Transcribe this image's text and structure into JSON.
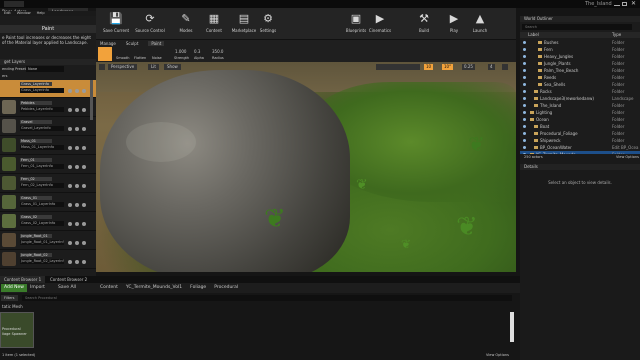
{
  "window": {
    "title": "The_Island",
    "menu": [
      "Edit",
      "Window",
      "Help"
    ],
    "tabs": [
      "Place Actors",
      "Landscape"
    ]
  },
  "mode_tabs": [
    "Paint"
  ],
  "paint_tooltip": "e Paint tool increases or decreases the eight of the Material layer applied to Landscape.",
  "target_layers": {
    "header": "get Layers",
    "blend_label": "ending Presets",
    "blend_value": "None",
    "section": "ers",
    "layers": [
      {
        "name": "Grass_Layerinfo",
        "field": "Grass_Layerinfo",
        "color": "#c98c3a",
        "selected": true
      },
      {
        "name": "Pebbles",
        "field": "Pebbles_LayerInfo",
        "color": "#6d6654"
      },
      {
        "name": "Gravel",
        "field": "Gravel_LayerInfo",
        "color": "#55524a"
      },
      {
        "name": "Moss_01",
        "field": "Moss_01_LayerInfo",
        "color": "#3f4d2a"
      },
      {
        "name": "Fern_01",
        "field": "Fern_01_LayerInfo",
        "color": "#4a5a2e"
      },
      {
        "name": "Fern_02",
        "field": "Fern_02_LayerInfo",
        "color": "#4d5833"
      },
      {
        "name": "Grass_01",
        "field": "Grass_01_LayerInfo",
        "color": "#56663a"
      },
      {
        "name": "Grass_02",
        "field": "Grass_02_LayerInfo",
        "color": "#5d6e3e"
      },
      {
        "name": "Jungle_Root_01",
        "field": "Jungle_Root_01_LayerInfo",
        "color": "#5a4a36"
      },
      {
        "name": "Jungle_Root_02",
        "field": "Jungle_Root_02_LayerInfo",
        "color": "#4f4030"
      }
    ]
  },
  "toolbar": {
    "buttons": [
      "Save Current",
      "Source Control",
      "Modes",
      "Content",
      "Marketplace",
      "Settings",
      "Blueprints",
      "Cinematics",
      "Build",
      "Play",
      "Launch"
    ],
    "glyphs": [
      "💾",
      "⟳",
      "✎",
      "▦",
      "▤",
      "⚙",
      "▣",
      "▶",
      "⚒",
      "▶",
      "▲"
    ]
  },
  "landscape_modes": [
    "Manage",
    "Sculpt",
    "Paint"
  ],
  "brush": {
    "tools": [
      "Paint",
      "Smooth",
      "Flatten",
      "Noise"
    ],
    "strength_label": "Strength",
    "strength_value": "1.000",
    "alpha_label": "Alpha",
    "alpha_value": "0.3",
    "radius_label": "Radius",
    "radius_value": "350.0"
  },
  "viewport": {
    "perspective": "Perspective",
    "lit": "Lit",
    "show": "Show",
    "grid_value": "10",
    "angle_value": "10°",
    "scale_value": "0.25",
    "cam_speed": "4"
  },
  "outliner": {
    "title": "World Outliner",
    "search_placeholder": "Search",
    "col_label": "Label",
    "col_type": "Type",
    "rows": [
      {
        "name": "Bushes",
        "type": "Folder",
        "indent": 3
      },
      {
        "name": "Fern",
        "type": "Folder",
        "indent": 3
      },
      {
        "name": "Heavy_Jungles",
        "type": "Folder",
        "indent": 3
      },
      {
        "name": "Jungle_Plants",
        "type": "Folder",
        "indent": 3
      },
      {
        "name": "Palm_Tree_Beach",
        "type": "Folder",
        "indent": 3
      },
      {
        "name": "Reeds",
        "type": "Folder",
        "indent": 3
      },
      {
        "name": "Sea_Shells",
        "type": "Folder",
        "indent": 3
      },
      {
        "name": "Rocks",
        "type": "Folder",
        "indent": 2
      },
      {
        "name": "Landscape3(reworkedanw)",
        "type": "Landscape",
        "indent": 2
      },
      {
        "name": "The_Island",
        "type": "Folder",
        "indent": 2
      },
      {
        "name": "Lighting",
        "type": "Folder",
        "indent": 1
      },
      {
        "name": "Ocean",
        "type": "Folder",
        "indent": 1
      },
      {
        "name": "Boat",
        "type": "Folder",
        "indent": 2
      },
      {
        "name": "Procedural_Foliage",
        "type": "Folder",
        "indent": 2
      },
      {
        "name": "Shipwreck",
        "type": "Folder",
        "indent": 2
      },
      {
        "name": "BP_OceanWater",
        "type": "Edit BP_Ocea",
        "indent": 2
      },
      {
        "name": "YC_Termite_Mounds",
        "type": "Folder",
        "indent": 1
      }
    ],
    "actor_count": "250 actors",
    "view_options": "View Options"
  },
  "details": {
    "title": "Details",
    "empty_text": "Select an object to view details."
  },
  "content_browser": {
    "tabs": [
      "Content Browser 1",
      "Content Browser 2"
    ],
    "add_new": "Add New",
    "import": "Import",
    "save_all": "Save All",
    "path": [
      "Content",
      "YC_Termite_Mounds_Vol1",
      "Foliage",
      "Procedural"
    ],
    "filters": "Filters",
    "search_placeholder": "Search Procedural",
    "category": "tatic Mesh",
    "asset_name": "Procedural\nliage Spawner",
    "status": "1 item (1 selected)",
    "view_options": "View Options"
  },
  "colors": {
    "accent": "#f2a23b",
    "selection_blue": "#1d4f8a",
    "panel_bg": "#1c1c1c"
  }
}
